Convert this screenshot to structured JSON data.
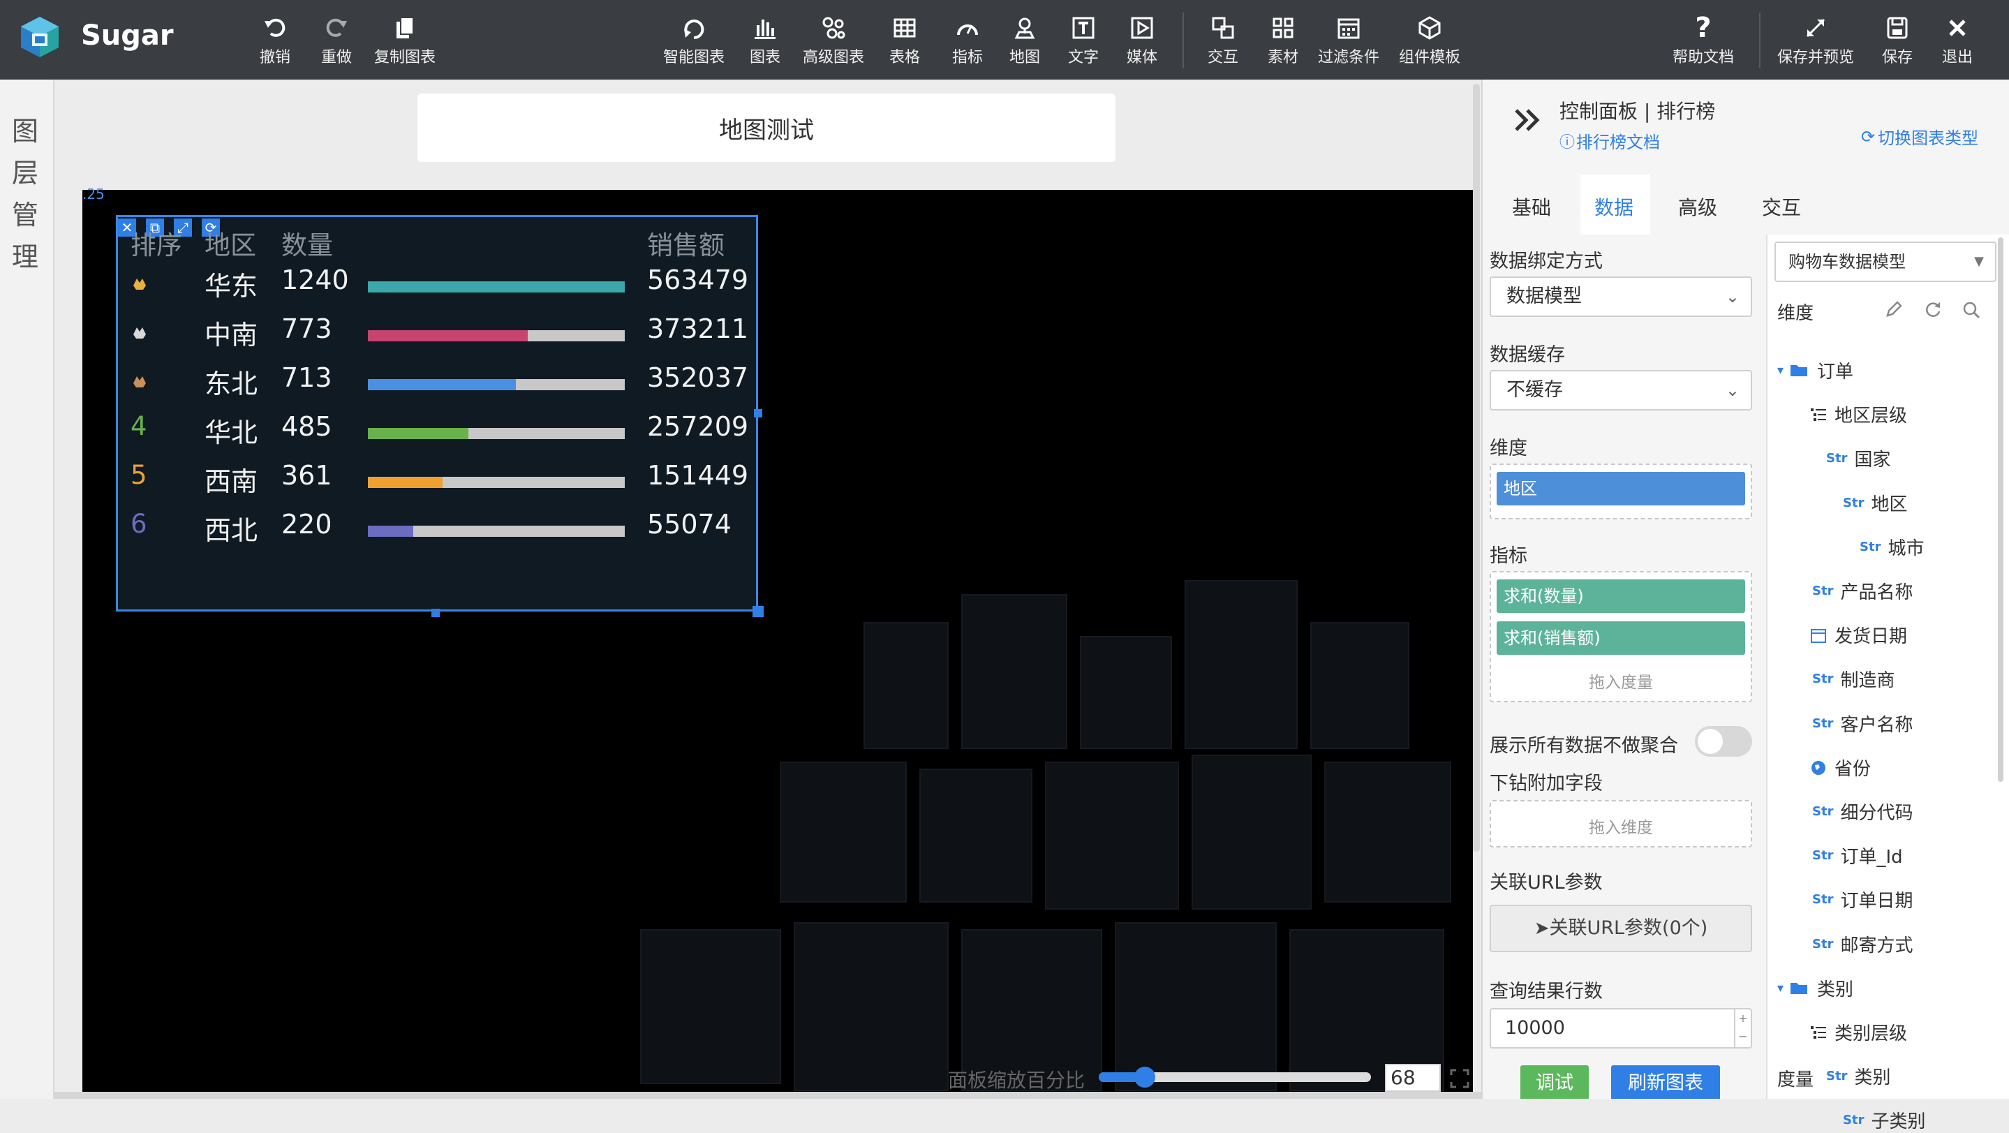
{
  "app": {
    "name": "Sugar"
  },
  "toolbar": {
    "left": [
      {
        "id": "undo",
        "label": "撤销"
      },
      {
        "id": "redo",
        "label": "重做"
      },
      {
        "id": "copy",
        "label": "复制图表"
      }
    ],
    "center": [
      {
        "id": "smart",
        "label": "智能图表"
      },
      {
        "id": "chart",
        "label": "图表"
      },
      {
        "id": "adv",
        "label": "高级图表"
      },
      {
        "id": "table",
        "label": "表格"
      },
      {
        "id": "indicator",
        "label": "指标"
      },
      {
        "id": "map",
        "label": "地图"
      },
      {
        "id": "text",
        "label": "文字"
      },
      {
        "id": "media",
        "label": "媒体"
      },
      {
        "id": "interact",
        "label": "交互"
      },
      {
        "id": "material",
        "label": "素材"
      },
      {
        "id": "filter",
        "label": "过滤条件"
      },
      {
        "id": "template",
        "label": "组件模板"
      }
    ],
    "right": [
      {
        "id": "help",
        "label": "帮助文档"
      },
      {
        "id": "savepreview",
        "label": "保存并预览"
      },
      {
        "id": "save",
        "label": "保存"
      },
      {
        "id": "exit",
        "label": "退出"
      }
    ]
  },
  "layer_panel": {
    "title": "图层管理"
  },
  "canvas": {
    "title": "地图测试",
    "ruler_text": ".25",
    "zoom_label": "面板缩放百分比",
    "zoom_value": "68",
    "zoom_fraction": 0.17
  },
  "ranking": {
    "headers": {
      "rank": "排序",
      "region": "地区",
      "qty": "数量",
      "sales": "销售额"
    },
    "rows": [
      {
        "rank": "1",
        "medal": "gold-medal-icon",
        "region": "华东",
        "qty": "1240",
        "sales": "563479",
        "ratio": 1.0,
        "color": "#3ba9ab"
      },
      {
        "rank": "2",
        "medal": "silver-medal-icon",
        "region": "中南",
        "qty": "773",
        "sales": "373211",
        "ratio": 0.623,
        "color": "#c6446f"
      },
      {
        "rank": "3",
        "medal": "bronze-medal-icon",
        "region": "东北",
        "qty": "713",
        "sales": "352037",
        "ratio": 0.575,
        "color": "#4a90e2"
      },
      {
        "rank": "4",
        "medal": "",
        "region": "华北",
        "qty": "485",
        "sales": "257209",
        "ratio": 0.391,
        "color": "#6ab04c"
      },
      {
        "rank": "5",
        "medal": "",
        "region": "西南",
        "qty": "361",
        "sales": "151449",
        "ratio": 0.291,
        "color": "#f0a030"
      },
      {
        "rank": "6",
        "medal": "",
        "region": "西北",
        "qty": "220",
        "sales": "55074",
        "ratio": 0.177,
        "color": "#6c6cc0"
      }
    ],
    "rank_colors": {
      "4": "#6ab04c",
      "5": "#f0a030",
      "6": "#6c6cc0"
    }
  },
  "panel": {
    "title": "控制面板 | 排行榜",
    "doc_link": "排行榜文档",
    "switch_link": "切换图表类型",
    "tabs": [
      "基础",
      "数据",
      "高级",
      "交互"
    ],
    "active_tab": "数据",
    "binding": {
      "label": "数据绑定方式",
      "value": "数据模型"
    },
    "cache": {
      "label": "数据缓存",
      "value": "不缓存"
    },
    "dimension": {
      "label": "维度",
      "chip": "地区"
    },
    "measure": {
      "label": "指标",
      "chips": [
        "求和(数量)",
        "求和(销售额)"
      ],
      "hint": "拖入度量"
    },
    "no_agg": {
      "label": "展示所有数据不做聚合",
      "on": false
    },
    "drill": {
      "label": "下钻附加字段",
      "hint": "拖入维度"
    },
    "url": {
      "label": "关联URL参数",
      "button": "关联URL参数(0个)"
    },
    "rows": {
      "label": "查询结果行数",
      "value": "10000"
    },
    "buttons": {
      "debug": "调试",
      "refresh": "刷新图表"
    }
  },
  "model": {
    "selected": "购物车数据模型",
    "dim_label": "维度",
    "measure_label": "度量",
    "tree": [
      {
        "type": "folder",
        "label": "订单",
        "level": 0
      },
      {
        "type": "hier",
        "label": "地区层级",
        "level": 1
      },
      {
        "type": "str",
        "label": "国家",
        "level": 2
      },
      {
        "type": "str",
        "label": "地区",
        "level": 3
      },
      {
        "type": "str",
        "label": "城市",
        "level": 4
      },
      {
        "type": "str",
        "label": "产品名称",
        "level": 1
      },
      {
        "type": "date",
        "label": "发货日期",
        "level": 1
      },
      {
        "type": "str",
        "label": "制造商",
        "level": 1
      },
      {
        "type": "str",
        "label": "客户名称",
        "level": 1
      },
      {
        "type": "geo",
        "label": "省份",
        "level": 1
      },
      {
        "type": "str",
        "label": "细分代码",
        "level": 1
      },
      {
        "type": "str",
        "label": "订单_Id",
        "level": 1
      },
      {
        "type": "str",
        "label": "订单日期",
        "level": 1
      },
      {
        "type": "str",
        "label": "邮寄方式",
        "level": 1
      },
      {
        "type": "folder",
        "label": "类别",
        "level": 0
      },
      {
        "type": "hier",
        "label": "类别层级",
        "level": 1
      },
      {
        "type": "str",
        "label": "类别",
        "level": 2
      },
      {
        "type": "str",
        "label": "子类别",
        "level": 3
      }
    ],
    "str_tag": "Str"
  },
  "colors": {
    "accent": "#2f7fe6",
    "chip_dim": "#4e8fd9",
    "chip_measure": "#5db39a",
    "debug": "#5cb85c"
  }
}
